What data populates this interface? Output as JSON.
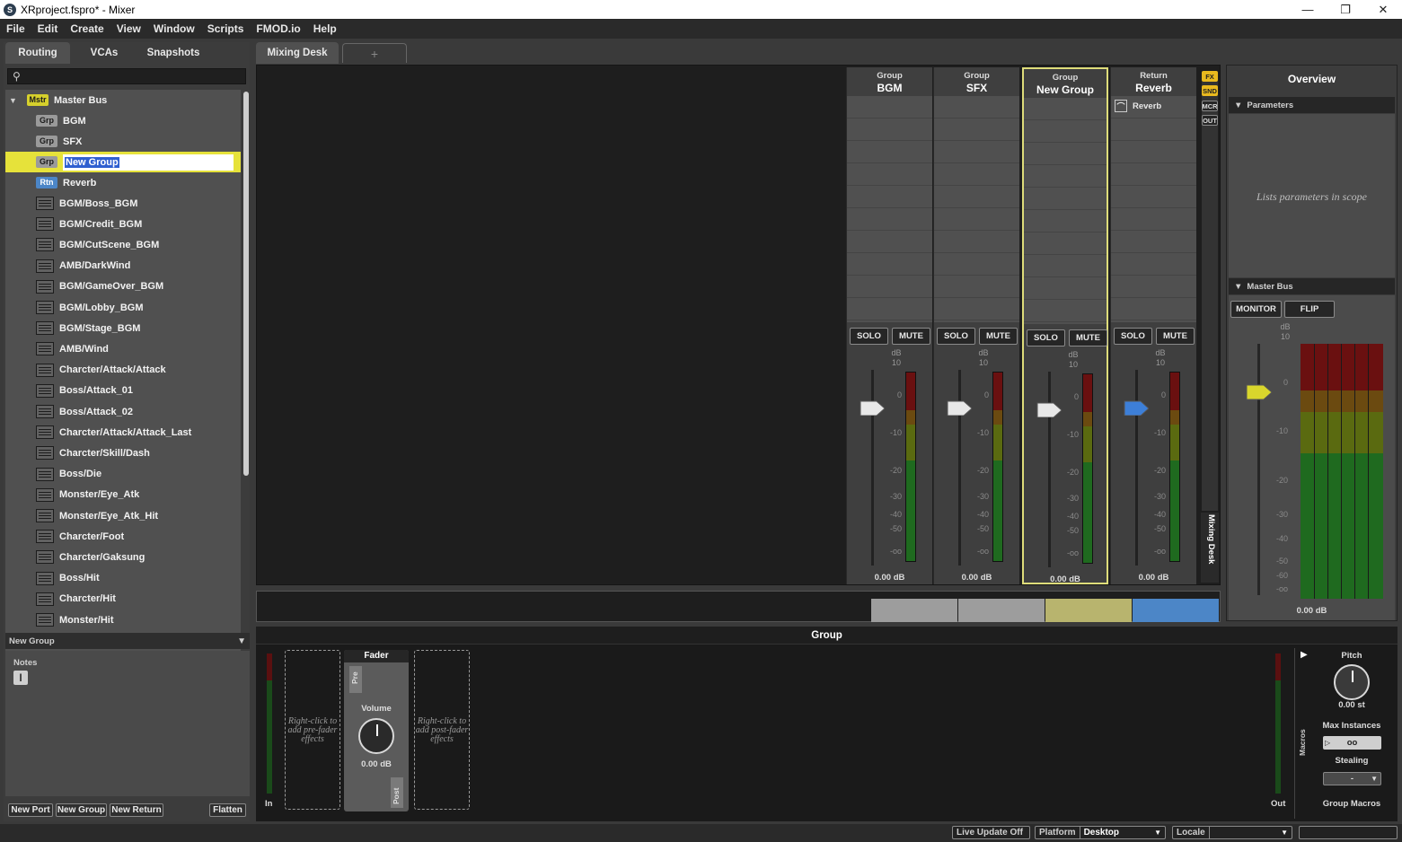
{
  "window": {
    "title": "XRproject.fspro* - Mixer",
    "app_icon": "S",
    "minimize": "—",
    "restore": "❐",
    "close": "✕"
  },
  "menu": [
    "File",
    "Edit",
    "Create",
    "View",
    "Window",
    "Scripts",
    "FMOD.io",
    "Help"
  ],
  "left_tabs": [
    "Routing",
    "VCAs",
    "Snapshots"
  ],
  "search": {
    "placeholder": ""
  },
  "tree": {
    "master": {
      "badge": "Mstr",
      "label": "Master Bus"
    },
    "buses": [
      {
        "badge": "Grp",
        "label": "BGM"
      },
      {
        "badge": "Grp",
        "label": "SFX"
      },
      {
        "badge": "Grp",
        "label": "New Group",
        "selected": true
      },
      {
        "badge": "Rtn",
        "label": "Reverb"
      }
    ],
    "events": [
      "BGM/Boss_BGM",
      "BGM/Credit_BGM",
      "BGM/CutScene_BGM",
      "AMB/DarkWind",
      "BGM/GameOver_BGM",
      "BGM/Lobby_BGM",
      "BGM/Stage_BGM",
      "AMB/Wind",
      "Charcter/Attack/Attack",
      "Boss/Attack_01",
      "Boss/Attack_02",
      "Charcter/Attack/Attack_Last",
      "Charcter/Skill/Dash",
      "Boss/Die",
      "Monster/Eye_Atk",
      "Monster/Eye_Atk_Hit",
      "Charcter/Foot",
      "Charcter/Gaksung",
      "Boss/Hit",
      "Charcter/Hit",
      "Monster/Hit"
    ]
  },
  "selection": {
    "name": "New Group",
    "notes_label": "Notes"
  },
  "left_buttons": [
    "New Port",
    "New Group",
    "New Return",
    "Flatten"
  ],
  "mixer_tabs": {
    "active": "Mixing Desk",
    "add": "+"
  },
  "strips": [
    {
      "type": "Group",
      "name": "BGM",
      "solo": "SOLO",
      "mute": "MUTE",
      "db_unit": "dB",
      "db_top": "10",
      "value": "0.00 dB",
      "handle_color": "#e8e8e8",
      "selected": false,
      "fx": ""
    },
    {
      "type": "Group",
      "name": "SFX",
      "solo": "SOLO",
      "mute": "MUTE",
      "db_unit": "dB",
      "db_top": "10",
      "value": "0.00 dB",
      "handle_color": "#e8e8e8",
      "selected": false,
      "fx": ""
    },
    {
      "type": "Group",
      "name": "New Group",
      "solo": "SOLO",
      "mute": "MUTE",
      "db_unit": "dB",
      "db_top": "10",
      "value": "0.00 dB",
      "handle_color": "#e8e8e8",
      "selected": true,
      "fx": ""
    },
    {
      "type": "Return",
      "name": "Reverb",
      "solo": "SOLO",
      "mute": "MUTE",
      "db_unit": "dB",
      "db_top": "10",
      "value": "0.00 dB",
      "handle_color": "#3d7fd8",
      "selected": false,
      "fx": "Reverb"
    }
  ],
  "scale_labels": [
    "0",
    "-10",
    "-20",
    "-30",
    "-40",
    "-50",
    "-oo"
  ],
  "side_tags": [
    "FX",
    "SND",
    "MCR",
    "OUT"
  ],
  "desk_vertical_tab": "Mixing Desk",
  "overview": {
    "title": "Overview",
    "parameters": "Parameters",
    "parameters_placeholder": "Lists parameters in scope",
    "master_bus": "Master Bus",
    "monitor": "MONITOR",
    "flip": "FLIP",
    "db_unit": "dB",
    "db_top": "10",
    "scale": [
      "0",
      "-10",
      "-20",
      "-30",
      "-40",
      "-50",
      "-60",
      "-oo"
    ],
    "value": "0.00 dB"
  },
  "deck": {
    "title": "Group",
    "in_label": "In",
    "out_label": "Out",
    "pre_hint": "Right-click to add pre-fader effects",
    "post_hint": "Right-click to add post-fader effects",
    "fader_title": "Fader",
    "pre_tag": "Pre",
    "post_tag": "Post",
    "volume_label": "Volume",
    "volume_value": "0.00 dB",
    "macros_label": "Macros",
    "pitch_label": "Pitch",
    "pitch_value": "0.00 st",
    "max_instances_label": "Max Instances",
    "max_instances_value": "oo",
    "stealing_label": "Stealing",
    "stealing_value": "-",
    "group_macros": "Group Macros"
  },
  "status": {
    "live_update": "Live Update Off",
    "platform_label": "Platform",
    "platform_value": "Desktop",
    "locale_label": "Locale",
    "locale_value": ""
  },
  "colors": {
    "accent_yellow": "#e6e23a",
    "return_blue": "#4c86c7",
    "meter_green": "#2f8a2f",
    "meter_yellow": "#8a8a22",
    "meter_red": "#8a1a1a"
  }
}
